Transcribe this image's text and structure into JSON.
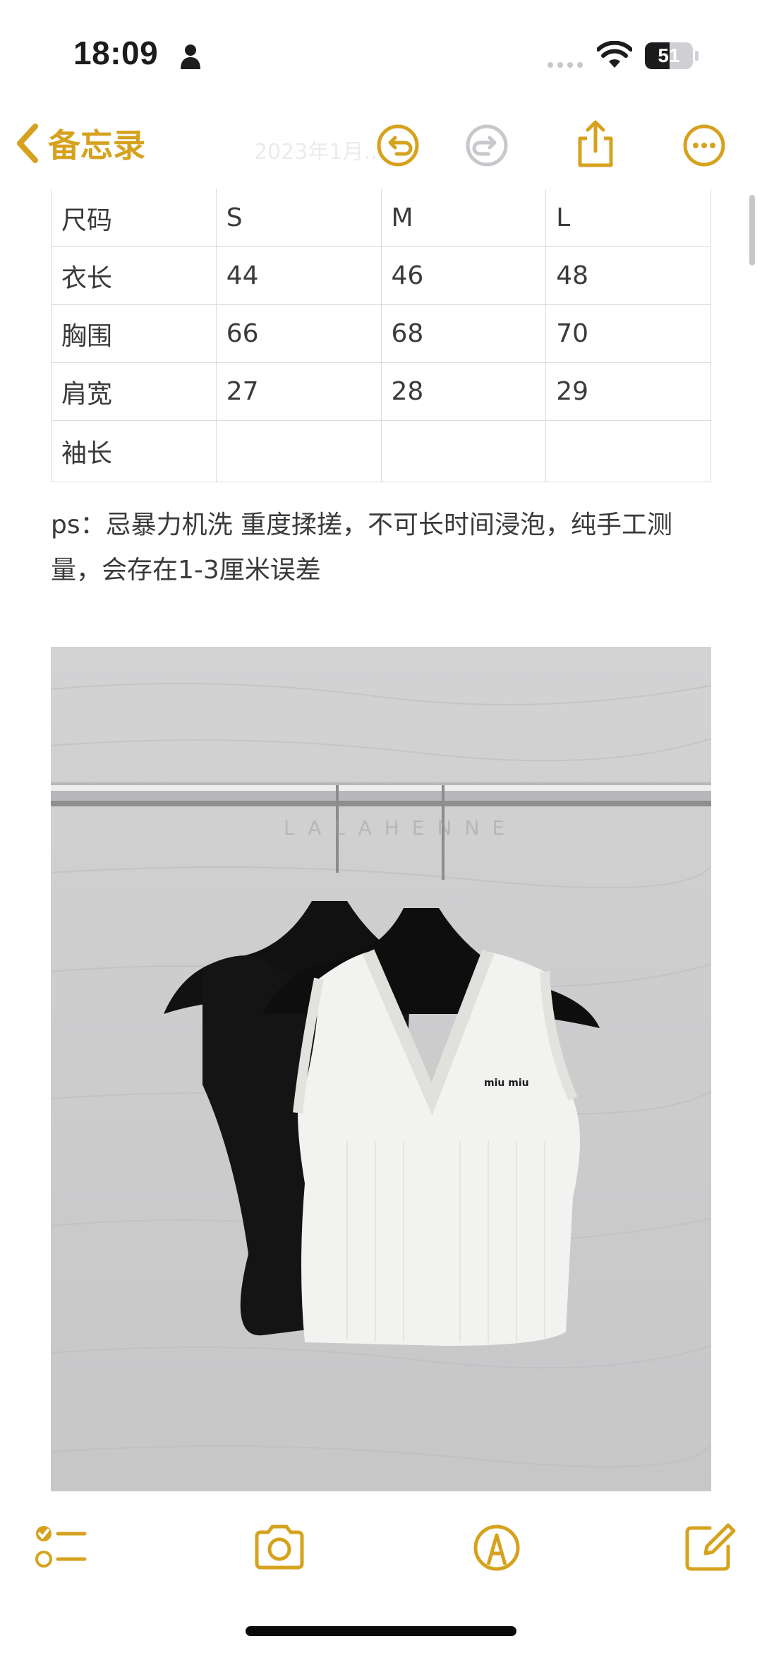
{
  "status_bar": {
    "time": "18:09",
    "battery": "51",
    "battery_level": 0.51
  },
  "nav": {
    "back_label": "备忘录",
    "faded_date": "2023年1月…",
    "accent_color": "#d6a21e",
    "icons": [
      "chevron-left-icon",
      "undo-icon",
      "redo-icon",
      "share-icon",
      "more-icon"
    ]
  },
  "table": {
    "rows": [
      [
        "尺码",
        "S",
        "M",
        "L"
      ],
      [
        "衣长",
        "44",
        "46",
        "48"
      ],
      [
        "胸围",
        "66",
        "68",
        "70"
      ],
      [
        "肩宽",
        "27",
        "28",
        "29"
      ],
      [
        "袖长",
        "",
        "",
        ""
      ]
    ]
  },
  "note": {
    "text": "ps：忌暴力机洗 重度揉搓，不可长时间浸泡，纯手工测量，会存在1-3厘米误差"
  },
  "photo": {
    "watermark": "LALAHENNE",
    "brand_label": "miu miu"
  },
  "toolbar": {
    "icons": [
      "checklist-icon",
      "camera-icon",
      "markup-icon",
      "compose-icon"
    ]
  }
}
